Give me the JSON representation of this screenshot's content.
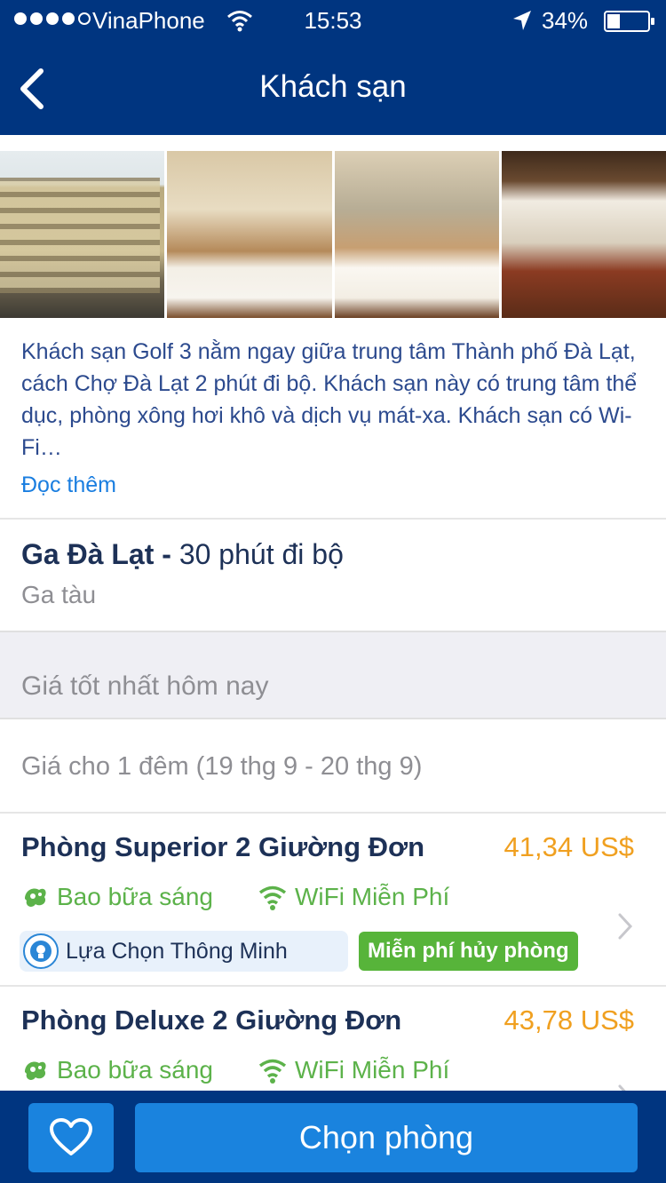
{
  "status_bar": {
    "carrier": "VinaPhone",
    "time": "15:53",
    "battery_pct": "34%",
    "battery_level": 0.34,
    "icons": [
      "signal-dots",
      "wifi-icon",
      "location-arrow-icon",
      "battery-icon"
    ]
  },
  "header": {
    "title": "Khách sạn",
    "back_icon": "chevron-left-icon"
  },
  "gallery": {
    "photos": [
      "hotel-exterior",
      "room-twin-bed",
      "room-twin-bed-window",
      "restaurant"
    ]
  },
  "description": {
    "text": "Khách sạn Golf 3 nằm ngay giữa trung tâm Thành phố Đà Lạt, cách Chợ Đà Lạt 2 phút đi bộ. Khách sạn này có trung tâm thể dục, phòng xông hơi khô và dịch vụ mát-xa. Khách sạn có Wi-Fi…",
    "read_more": "Đọc thêm"
  },
  "station": {
    "name": "Ga Đà Lạt -",
    "distance": "30 phút đi bộ",
    "type": "Ga tàu"
  },
  "best_price": {
    "label": "Giá tốt nhất hôm nay"
  },
  "price_info": {
    "per_night": "Giá cho 1 đêm (19 thg 9 - 20 thg 9)"
  },
  "rooms": [
    {
      "name": "Phòng Superior 2 Giường Đơn",
      "price": "41,34 US$",
      "breakfast": "Bao bữa sáng",
      "wifi": "WiFi Miễn Phí",
      "smart_choice": "Lựa Chọn Thông Minh",
      "free_cancel": "Miễn phí hủy phòng"
    },
    {
      "name": "Phòng Deluxe 2 Giường Đơn",
      "price": "43,78 US$",
      "breakfast": "Bao bữa sáng",
      "wifi": "WiFi Miễn Phí"
    }
  ],
  "bottom_bar": {
    "select_label": "Chọn phòng",
    "favorite_icon": "heart-icon"
  },
  "colors": {
    "brand": "#003580",
    "button": "#1a83de",
    "price": "#f0a020",
    "amenity": "#5cb24a",
    "link": "#1a7ee0"
  }
}
